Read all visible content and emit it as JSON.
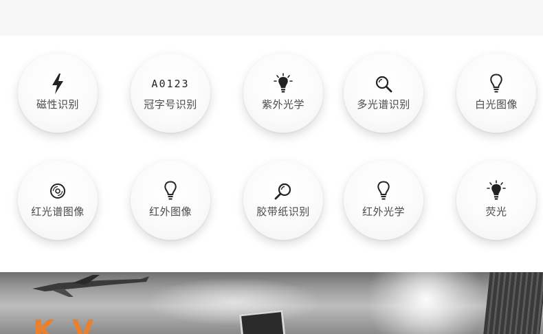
{
  "features": [
    {
      "label": "磁性识别",
      "icon": "lightning-icon"
    },
    {
      "label": "冠字号识别",
      "icon": "serial-number-text",
      "code": "A0123"
    },
    {
      "label": "紫外光学",
      "icon": "bulb-rays-icon"
    },
    {
      "label": "多光谱识别",
      "icon": "magnifier-icon"
    },
    {
      "label": "白光图像",
      "icon": "bulb-outline-icon"
    },
    {
      "label": "红光谱图像",
      "icon": "disc-icon"
    },
    {
      "label": "红外图像",
      "icon": "bulb-outline-icon"
    },
    {
      "label": "胶带纸识别",
      "icon": "magnifier-icon"
    },
    {
      "label": "红外光学",
      "icon": "bulb-outline-icon"
    },
    {
      "label": "荧光",
      "icon": "bulb-rays-icon"
    }
  ],
  "banner": {
    "partial_text": "K V",
    "accent_color": "#e8802e"
  },
  "colors": {
    "label": "#4a4a4a",
    "icon": "#222222",
    "panel_bg": "#ffffff",
    "band_bg": "#f6f6f6"
  }
}
